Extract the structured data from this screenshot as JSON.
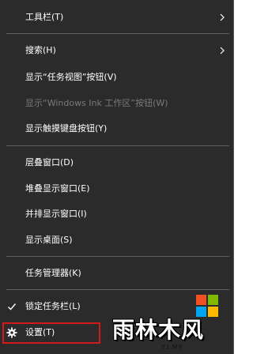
{
  "context_menu": {
    "items": [
      {
        "label": "工具栏(T)",
        "submenu": true
      },
      {
        "label": "搜索(H)",
        "submenu": true
      },
      {
        "label": "显示“任务视图”按钮(V)"
      },
      {
        "label": "显示“Windows Ink 工作区”按钮(W)",
        "disabled": true
      },
      {
        "label": "显示触摸键盘按钮(Y)"
      },
      {
        "label": "层叠窗口(D)"
      },
      {
        "label": "堆叠显示窗口(E)"
      },
      {
        "label": "并排显示窗口(I)"
      },
      {
        "label": "显示桌面(S)"
      },
      {
        "label": "任务管理器(K)"
      },
      {
        "label": "锁定任务栏(L)",
        "checked": true
      },
      {
        "label": "设置(T)",
        "icon": "gear-icon",
        "highlighted": true
      }
    ]
  },
  "watermark": {
    "brand_text": "雨林木风",
    "sub_text": "YLMF",
    "logo_colors": [
      "#f25022",
      "#7fba00",
      "#00a4ef",
      "#ffb900"
    ]
  },
  "colors": {
    "menu_bg": "#2b2b2b",
    "text": "#ffffff",
    "disabled_text": "#7a7a7a",
    "separator": "#5f5f5f",
    "highlight_border": "#d21a1a"
  }
}
